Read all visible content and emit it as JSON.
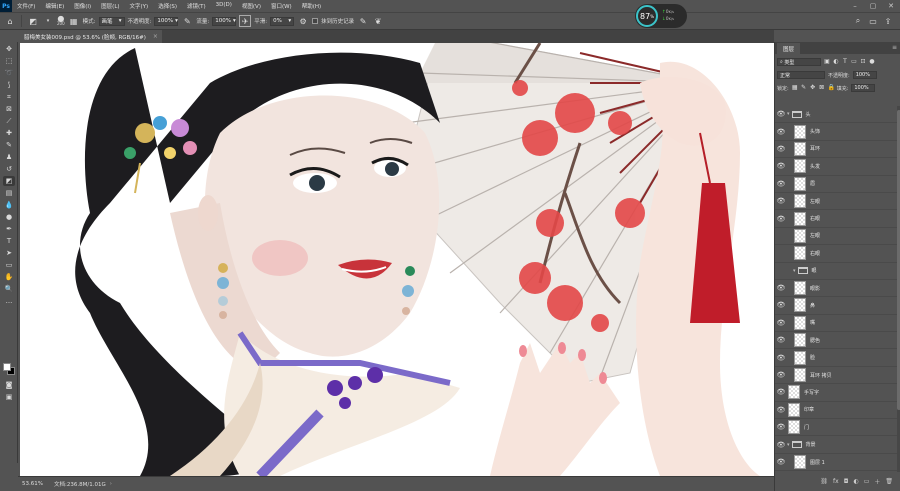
{
  "app": {
    "logo": "Ps"
  },
  "menu": [
    "文件(F)",
    "编辑(E)",
    "图像(I)",
    "图层(L)",
    "文字(Y)",
    "选择(S)",
    "滤镜(T)",
    "3D(D)",
    "视图(V)",
    "窗口(W)",
    "帮助(H)"
  ],
  "perf": {
    "value": "87",
    "unit": "%",
    "up": "0",
    "down": "0",
    "up_unit": "K/s",
    "down_unit": "K/s"
  },
  "options": {
    "brush_size": "200",
    "mode_label": "模式:",
    "mode_value": "画笔",
    "opacity_label": "不透明度:",
    "opacity_value": "100%",
    "flow_label": "流量:",
    "flow_value": "100%",
    "smooth_label": "平滑:",
    "smooth_value": "0%",
    "erase_history": "抹到历史记录"
  },
  "document": {
    "tab_title": "腊梅美女装009.psd @ 53.6% (脸颊, RGB/16#)",
    "zoom": "53.61%",
    "doc_info": "文档:236.8M/1.01G"
  },
  "layers_panel": {
    "tab": "图层",
    "filter_label": "类型",
    "blend_mode": "正常",
    "opacity_label": "不透明度:",
    "opacity_value": "100%",
    "lock_label": "锁定:",
    "fill_label": "填充:",
    "fill_value": "100%",
    "layers": [
      {
        "name": "头",
        "kind": "group",
        "visible": true,
        "indent": 0
      },
      {
        "name": "头饰",
        "kind": "layer",
        "visible": true,
        "indent": 1
      },
      {
        "name": "耳环",
        "kind": "layer",
        "visible": true,
        "indent": 1
      },
      {
        "name": "头发",
        "kind": "layer",
        "visible": true,
        "indent": 1
      },
      {
        "name": "眉",
        "kind": "layer",
        "visible": true,
        "indent": 1
      },
      {
        "name": "左眼",
        "kind": "layer",
        "visible": true,
        "indent": 1
      },
      {
        "name": "右眼",
        "kind": "layer",
        "visible": true,
        "indent": 1
      },
      {
        "name": "左眼",
        "kind": "layer",
        "visible": false,
        "indent": 1
      },
      {
        "name": "右眼",
        "kind": "layer",
        "visible": false,
        "indent": 1
      },
      {
        "name": "眼",
        "kind": "group",
        "visible": false,
        "indent": 1
      },
      {
        "name": "眼影",
        "kind": "layer",
        "visible": true,
        "indent": 1
      },
      {
        "name": "鼻",
        "kind": "layer",
        "visible": true,
        "indent": 1
      },
      {
        "name": "嘴",
        "kind": "layer",
        "visible": true,
        "indent": 1
      },
      {
        "name": "腮色",
        "kind": "layer",
        "visible": true,
        "indent": 1
      },
      {
        "name": "脸",
        "kind": "layer",
        "visible": true,
        "indent": 1
      },
      {
        "name": "耳环 拷贝",
        "kind": "layer",
        "visible": true,
        "indent": 1
      },
      {
        "name": "手写字",
        "kind": "layer",
        "visible": true,
        "indent": 0
      },
      {
        "name": "印章",
        "kind": "layer",
        "visible": true,
        "indent": 0
      },
      {
        "name": "门",
        "kind": "layer",
        "visible": true,
        "indent": 0
      },
      {
        "name": "背景",
        "kind": "group",
        "visible": true,
        "indent": 0
      },
      {
        "name": "图层 1",
        "kind": "layer",
        "visible": true,
        "indent": 1
      }
    ]
  },
  "colors": {
    "ui_bg": "#535353",
    "panel_dark": "#424242",
    "accent": "#31a8ff",
    "lips": "#c8333a"
  }
}
